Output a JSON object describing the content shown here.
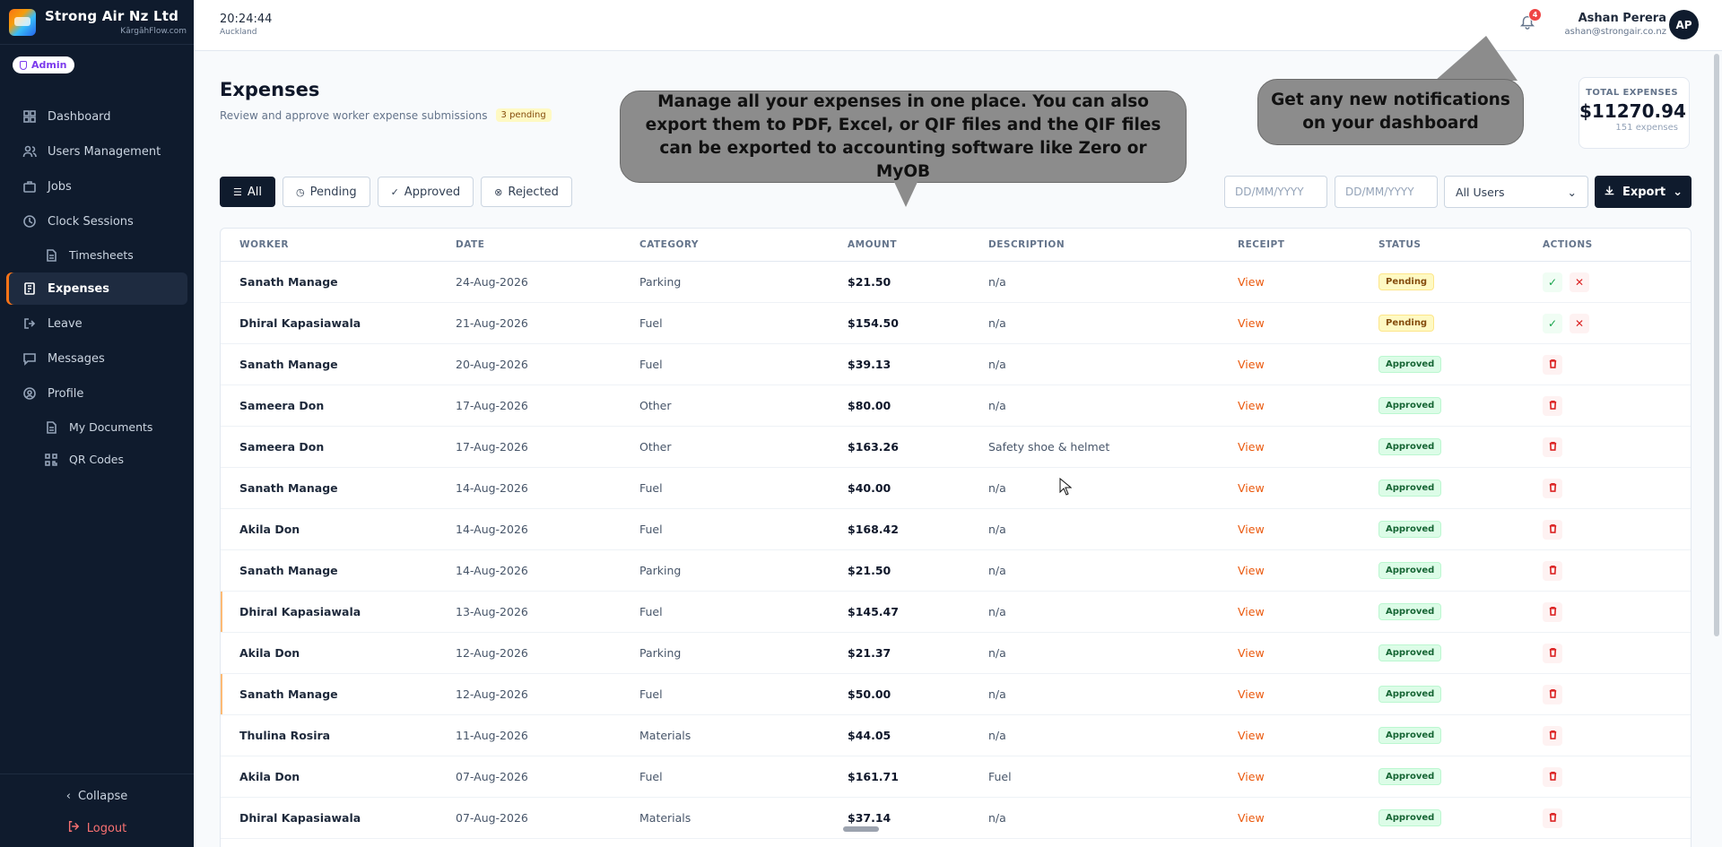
{
  "brand": {
    "name": "Strong Air Nz Ltd",
    "sub": "KārgāhFlow.com"
  },
  "role_badge": "Admin",
  "nav": [
    {
      "label": "Dashboard",
      "icon": "dashboard-icon",
      "sub": false,
      "active": false
    },
    {
      "label": "Users Management",
      "icon": "users-icon",
      "sub": false,
      "active": false
    },
    {
      "label": "Jobs",
      "icon": "briefcase-icon",
      "sub": false,
      "active": false
    },
    {
      "label": "Clock Sessions",
      "icon": "clock-icon",
      "sub": false,
      "active": false
    },
    {
      "label": "Timesheets",
      "icon": "document-icon",
      "sub": true,
      "active": false
    },
    {
      "label": "Expenses",
      "icon": "receipt-icon",
      "sub": false,
      "active": true
    },
    {
      "label": "Leave",
      "icon": "leave-icon",
      "sub": false,
      "active": false
    },
    {
      "label": "Messages",
      "icon": "message-icon",
      "sub": false,
      "active": false
    },
    {
      "label": "Profile",
      "icon": "profile-icon",
      "sub": false,
      "active": false
    },
    {
      "label": "My Documents",
      "icon": "document-icon",
      "sub": true,
      "active": false
    },
    {
      "label": "QR Codes",
      "icon": "qr-icon",
      "sub": true,
      "active": false
    }
  ],
  "sidebar_footer": {
    "collapse": "Collapse",
    "logout": "Logout"
  },
  "header": {
    "time": "20:24:44",
    "timezone": "Auckland",
    "notification_count": "4",
    "user_name": "Ashan Perera",
    "user_email": "ashan@strongair.co.nz",
    "avatar_initials": "AP"
  },
  "page": {
    "title": "Expenses",
    "subtitle": "Review and approve worker expense submissions",
    "pending_badge": "3 pending"
  },
  "total": {
    "label": "TOTAL EXPENSES",
    "value": "$11270.94",
    "count": "151 expenses"
  },
  "filters": {
    "tabs": [
      {
        "label": "All",
        "icon": "list-icon",
        "active": true
      },
      {
        "label": "Pending",
        "icon": "clock-icon",
        "active": false
      },
      {
        "label": "Approved",
        "icon": "check-circle-icon",
        "active": false
      },
      {
        "label": "Rejected",
        "icon": "x-circle-icon",
        "active": false
      }
    ],
    "date_from_placeholder": "DD/MM/YYYY",
    "date_to_placeholder": "DD/MM/YYYY",
    "user_select": "All Users",
    "export_label": "Export"
  },
  "table": {
    "headers": [
      "WORKER",
      "DATE",
      "CATEGORY",
      "AMOUNT",
      "DESCRIPTION",
      "RECEIPT",
      "STATUS",
      "ACTIONS"
    ],
    "rows": [
      {
        "worker": "Sanath Manage",
        "date": "24-Aug-2026",
        "category": "Parking",
        "amount": "$21.50",
        "description": "n/a",
        "receipt": "View",
        "status": "Pending"
      },
      {
        "worker": "Dhiral Kapasiawala",
        "date": "21-Aug-2026",
        "category": "Fuel",
        "amount": "$154.50",
        "description": "n/a",
        "receipt": "View",
        "status": "Pending"
      },
      {
        "worker": "Sanath Manage",
        "date": "20-Aug-2026",
        "category": "Fuel",
        "amount": "$39.13",
        "description": "n/a",
        "receipt": "View",
        "status": "Approved"
      },
      {
        "worker": "Sameera Don",
        "date": "17-Aug-2026",
        "category": "Other",
        "amount": "$80.00",
        "description": "n/a",
        "receipt": "View",
        "status": "Approved"
      },
      {
        "worker": "Sameera Don",
        "date": "17-Aug-2026",
        "category": "Other",
        "amount": "$163.26",
        "description": "Safety shoe & helmet",
        "receipt": "View",
        "status": "Approved"
      },
      {
        "worker": "Sanath Manage",
        "date": "14-Aug-2026",
        "category": "Fuel",
        "amount": "$40.00",
        "description": "n/a",
        "receipt": "View",
        "status": "Approved"
      },
      {
        "worker": "Akila Don",
        "date": "14-Aug-2026",
        "category": "Fuel",
        "amount": "$168.42",
        "description": "n/a",
        "receipt": "View",
        "status": "Approved"
      },
      {
        "worker": "Sanath Manage",
        "date": "14-Aug-2026",
        "category": "Parking",
        "amount": "$21.50",
        "description": "n/a",
        "receipt": "View",
        "status": "Approved"
      },
      {
        "worker": "Dhiral Kapasiawala",
        "date": "13-Aug-2026",
        "category": "Fuel",
        "amount": "$145.47",
        "description": "n/a",
        "receipt": "View",
        "status": "Approved"
      },
      {
        "worker": "Akila Don",
        "date": "12-Aug-2026",
        "category": "Parking",
        "amount": "$21.37",
        "description": "n/a",
        "receipt": "View",
        "status": "Approved"
      },
      {
        "worker": "Sanath Manage",
        "date": "12-Aug-2026",
        "category": "Fuel",
        "amount": "$50.00",
        "description": "n/a",
        "receipt": "View",
        "status": "Approved"
      },
      {
        "worker": "Thulina Rosira",
        "date": "11-Aug-2026",
        "category": "Materials",
        "amount": "$44.05",
        "description": "n/a",
        "receipt": "View",
        "status": "Approved"
      },
      {
        "worker": "Akila Don",
        "date": "07-Aug-2026",
        "category": "Fuel",
        "amount": "$161.71",
        "description": "Fuel",
        "receipt": "View",
        "status": "Approved"
      },
      {
        "worker": "Dhiral Kapasiawala",
        "date": "07-Aug-2026",
        "category": "Materials",
        "amount": "$37.14",
        "description": "n/a",
        "receipt": "View",
        "status": "Approved"
      }
    ]
  },
  "tooltips": {
    "main": "Manage all your expenses in one place. You can also export them to PDF, Excel, or QIF files and the QIF files can be exported to accounting software like Zero or MyOB",
    "notifications": "Get any new notifications on your dashboard"
  }
}
